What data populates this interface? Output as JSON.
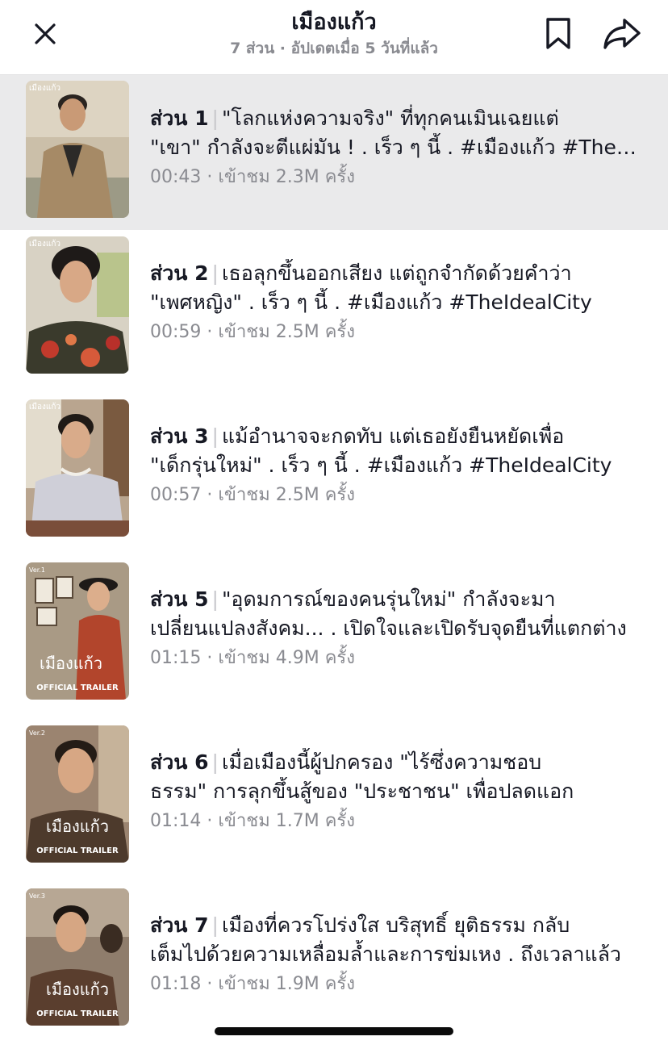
{
  "header": {
    "title": "เมืองแก้ว",
    "subtitle": "7 ส่วน · อัปเดตเมื่อ 5 วันที่แล้ว",
    "close_icon": "close-icon",
    "bookmark_icon": "bookmark-icon",
    "share_icon": "share-icon"
  },
  "colors": {
    "active_row_bg": "#eaeaeb",
    "meta_text": "#8a8b91",
    "primary_text": "#161823"
  },
  "episodes": [
    {
      "part": "ส่วน 1",
      "line1": "\"โลกแห่งความจริง\" ที่ทุกคนเมินเฉยแต่",
      "line2": "\"เขา\" กำลังจะตีแผ่มัน ! . เร็ว ๆ นี้ . #เมืองแก้ว #TheIdealCity",
      "duration": "00:43",
      "views": "เข้าชม 2.3M ครั้ง",
      "active": true
    },
    {
      "part": "ส่วน 2",
      "line1": "เธอลุกขึ้นออกเสียง แต่ถูกจำกัดด้วยคำว่า",
      "line2": "\"เพศหญิง\" . เร็ว ๆ นี้ . #เมืองแก้ว #TheIdealCity",
      "duration": "00:59",
      "views": "เข้าชม 2.5M ครั้ง",
      "active": false
    },
    {
      "part": "ส่วน 3",
      "line1": "แม้อำนาจจะกดทับ แต่เธอยังยืนหยัดเพื่อ",
      "line2": "\"เด็กรุ่นใหม่\" . เร็ว ๆ นี้ . #เมืองแก้ว #TheIdealCity",
      "duration": "00:57",
      "views": "เข้าชม 2.5M ครั้ง",
      "active": false
    },
    {
      "part": "ส่วน 5",
      "line1": "\"อุดมการณ์ของคนรุ่นใหม่\" กำลังจะมา",
      "line2": "เปลี่ยนแปลงสังคม... . เปิดใจและเปิดรับจุดยืนที่แตกต่าง",
      "duration": "01:15",
      "views": "เข้าชม 4.9M ครั้ง",
      "active": false
    },
    {
      "part": "ส่วน 6",
      "line1": "เมื่อเมืองนี้ผู้ปกครอง \"ไร้ซึ่งความชอบ",
      "line2": "ธรรม\" การลุกขึ้นสู้ของ \"ประชาชน\" เพื่อปลดแอก",
      "duration": "01:14",
      "views": "เข้าชม 1.7M ครั้ง",
      "active": false
    },
    {
      "part": "ส่วน 7",
      "line1": "เมืองที่ควรโปร่งใส บริสุทธิ์ ยุติธรรม กลับ",
      "line2": "เต็มไปด้วยความเหลื่อมล้ำและการข่มเหง . ถึงเวลาแล้ว",
      "duration": "01:18",
      "views": "เข้าชม 1.9M ครั้ง",
      "active": false
    }
  ],
  "thumbnails": [
    {
      "logo_text": "เมืองแก้ว",
      "bg": "#cbbfa9",
      "shirt": "#a68a66",
      "skin": "#c99a76"
    },
    {
      "logo_text": "เมืองแก้ว",
      "bg": "#d8d2c4",
      "shirt": "#3a3a2c",
      "skin": "#d8a886"
    },
    {
      "logo_text": "เมืองแก้ว",
      "bg": "#b9a58f",
      "shirt": "#cfcfd8",
      "skin": "#d9ab8a"
    },
    {
      "logo_text": "เมืองแก้ว",
      "badge": "OFFICIAL TRAILER",
      "ver": "Ver.1",
      "bg": "#a99a85",
      "shirt": "#b2452c",
      "skin": "#dcae8c"
    },
    {
      "logo_text": "เมืองแก้ว",
      "badge": "OFFICIAL TRAILER",
      "ver": "Ver.2",
      "bg": "#9b8470",
      "shirt": "#4d3a2c",
      "skin": "#d7a784"
    },
    {
      "logo_text": "เมืองแก้ว",
      "badge": "OFFICIAL TRAILER",
      "ver": "Ver.3",
      "bg": "#8f7d6c",
      "shirt": "#5a3e2e",
      "skin": "#d6a683"
    }
  ]
}
